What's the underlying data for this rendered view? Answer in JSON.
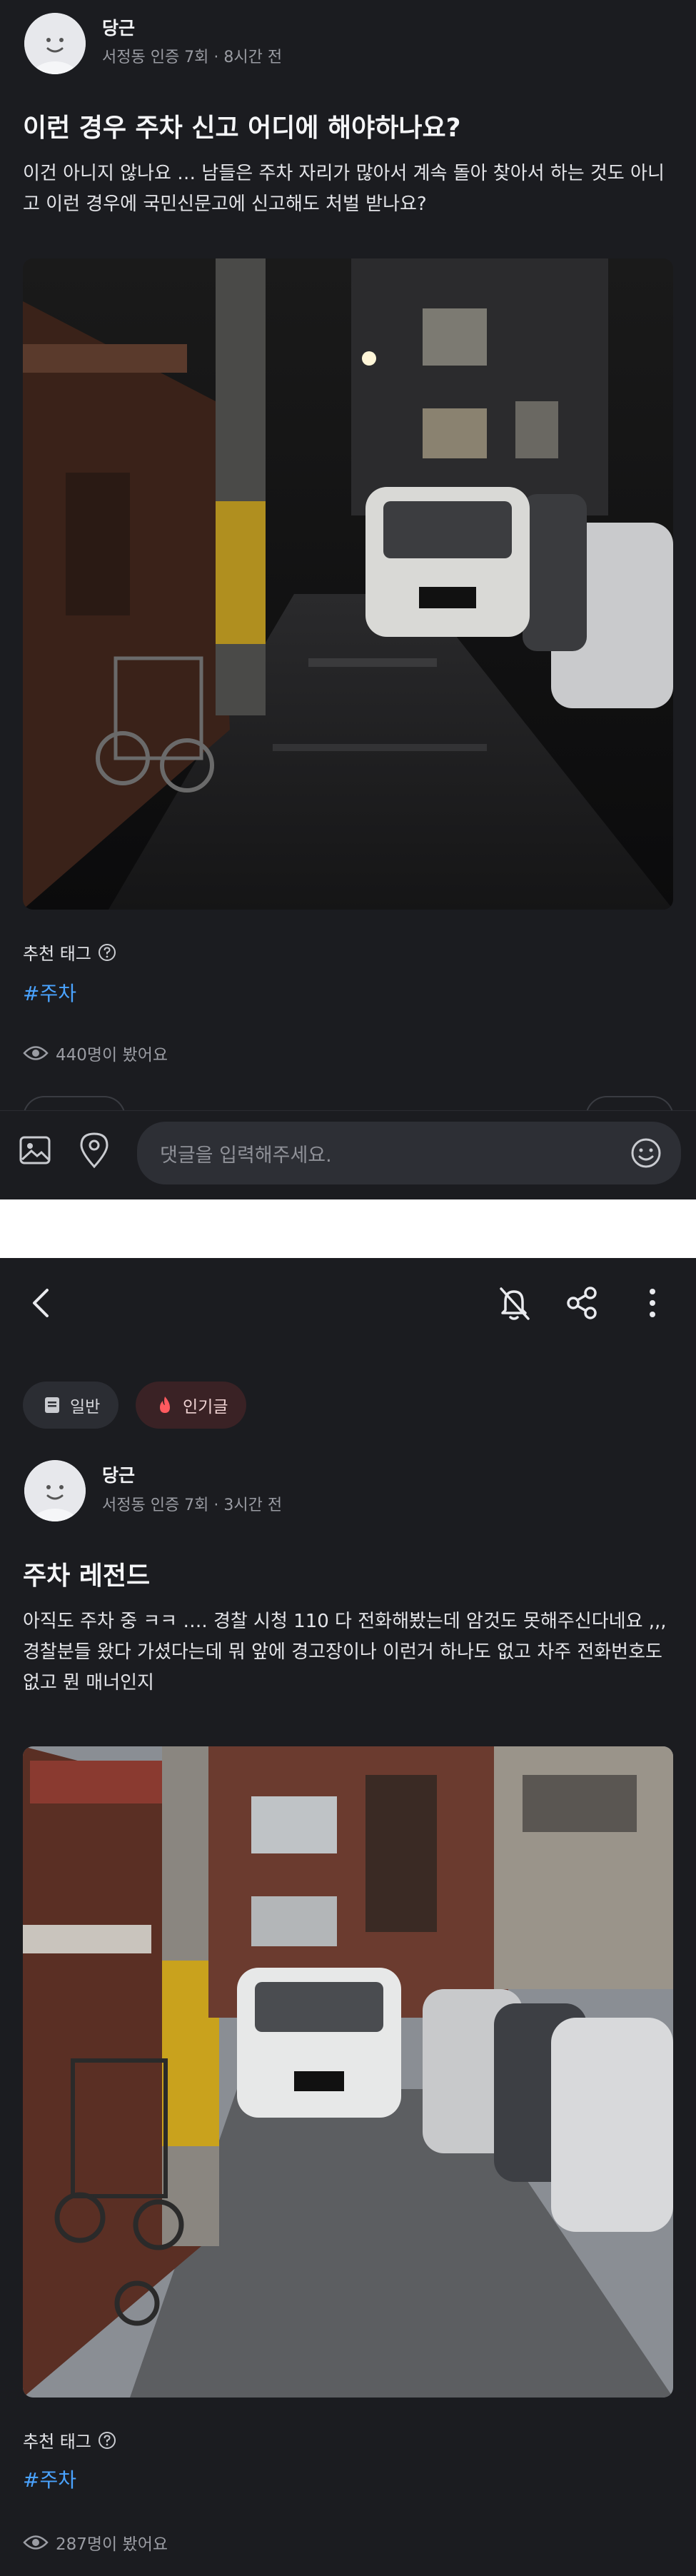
{
  "post1": {
    "author_name": "당근",
    "author_meta": "서정동 인증 7회 · 8시간 전",
    "title": "이런 경우 주차 신고 어디에 해야하나요?",
    "body": "이건 아니지 않나요 … 남들은 주차 자리가 많아서 계속 돌아 찾아서 하는 것도 아니고 이런 경우에 국민신문고에 신고해도 처벌 받나요?",
    "tag_label": "추천 태그",
    "hashtag": "#주차",
    "views": "440명이 봤어요"
  },
  "comment_bar": {
    "placeholder": "댓글을 입력해주세요."
  },
  "post2": {
    "chip_general": "일반",
    "chip_popular": "인기글",
    "author_name": "당근",
    "author_meta": "서정동 인증 7회 · 3시간 전",
    "title": "주차 레전드",
    "body": "아직도 주차 중 ㅋㅋ …. 경찰 시청 110 다 전화해봤는데 암것도 못해주신다네요 ,,, 경찰분들 왔다 가셨다는데 뭐 앞에 경고장이나 이런거 하나도 없고 차주 전화번호도 없고 뭔 매너인지",
    "tag_label": "추천 태그",
    "hashtag": "#주차",
    "views": "287명이 봤어요"
  },
  "colors": {
    "background": "#1b1c20",
    "hashtag": "#4aa3ff",
    "popular_chip": "#3a2225",
    "popular_fire": "#ff5a5f"
  },
  "icons": {
    "back": "chevron-left-icon",
    "notify_off": "bell-off-icon",
    "share": "share-icon",
    "more": "more-vertical-icon",
    "gallery": "image-icon",
    "location": "location-pin-icon",
    "emoji": "smile-icon",
    "eye": "eye-icon",
    "help": "question-circle-icon"
  }
}
